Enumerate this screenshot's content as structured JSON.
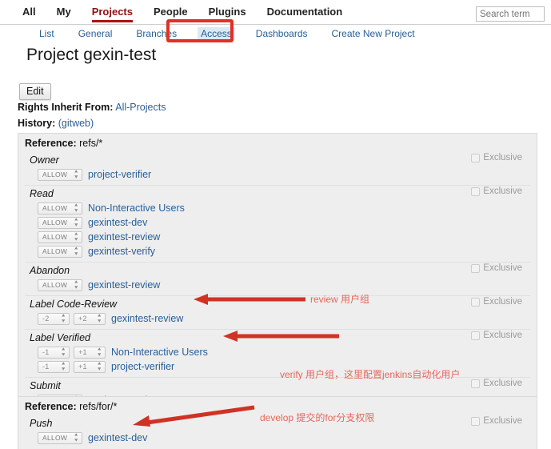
{
  "topnav": {
    "items": [
      {
        "label": "All",
        "active": false
      },
      {
        "label": "My",
        "active": false
      },
      {
        "label": "Projects",
        "active": true
      },
      {
        "label": "People",
        "active": false
      },
      {
        "label": "Plugins",
        "active": false
      },
      {
        "label": "Documentation",
        "active": false
      }
    ],
    "search_placeholder": "Search term",
    "search_value": ""
  },
  "subnav": {
    "items": [
      {
        "label": "List",
        "current": false
      },
      {
        "label": "General",
        "current": false
      },
      {
        "label": "Branches",
        "current": false
      },
      {
        "label": "Access",
        "current": true
      },
      {
        "label": "Dashboards",
        "current": false
      },
      {
        "label": "Create New Project",
        "current": false
      }
    ]
  },
  "page": {
    "title": "Project gexin-test",
    "edit_label": "Edit",
    "rights_label": "Rights Inherit From:",
    "rights_value": "All-Projects",
    "history_label": "History:",
    "history_value": "(gitweb)"
  },
  "exclusive_label": "Exclusive",
  "sections": [
    {
      "ref_label": "Reference:",
      "ref_value": "refs/*",
      "permissions": [
        {
          "name": "Owner",
          "exclusive": true,
          "rules": [
            {
              "selects": [
                "ALLOW"
              ],
              "group": "project-verifier"
            }
          ]
        },
        {
          "name": "Read",
          "exclusive": true,
          "rules": [
            {
              "selects": [
                "ALLOW"
              ],
              "group": "Non-Interactive Users"
            },
            {
              "selects": [
                "ALLOW"
              ],
              "group": "gexintest-dev"
            },
            {
              "selects": [
                "ALLOW"
              ],
              "group": "gexintest-review"
            },
            {
              "selects": [
                "ALLOW"
              ],
              "group": "gexintest-verify"
            }
          ]
        },
        {
          "name": "Abandon",
          "exclusive": true,
          "rules": [
            {
              "selects": [
                "ALLOW"
              ],
              "group": "gexintest-review"
            }
          ]
        },
        {
          "name": "Label Code-Review",
          "exclusive": true,
          "rules": [
            {
              "selects": [
                "-2",
                "+2"
              ],
              "group": "gexintest-review"
            }
          ]
        },
        {
          "name": "Label Verified",
          "exclusive": true,
          "rules": [
            {
              "selects": [
                "-1",
                "+1"
              ],
              "group": "Non-Interactive Users"
            },
            {
              "selects": [
                "-1",
                "+1"
              ],
              "group": "project-verifier"
            }
          ]
        },
        {
          "name": "Submit",
          "exclusive": true,
          "rules": [
            {
              "selects": [
                "ALLOW"
              ],
              "group": "gexintest-review"
            }
          ]
        }
      ]
    },
    {
      "ref_label": "Reference:",
      "ref_value": "refs/for/*",
      "permissions": [
        {
          "name": "Push",
          "exclusive": true,
          "rules": [
            {
              "selects": [
                "ALLOW"
              ],
              "group": "gexintest-dev"
            }
          ]
        }
      ]
    }
  ],
  "annotations": {
    "review": "review 用户组",
    "verify": "verify 用户组，这里配置jenkins自动化用户",
    "develop": "develop 提交的for分支权限"
  },
  "colors": {
    "accent_red": "#e23122",
    "annotation_red": "#e4685d",
    "link_blue": "#2a6099",
    "active_tab_red": "#8c1111",
    "panel_bg": "#eeeeee"
  }
}
